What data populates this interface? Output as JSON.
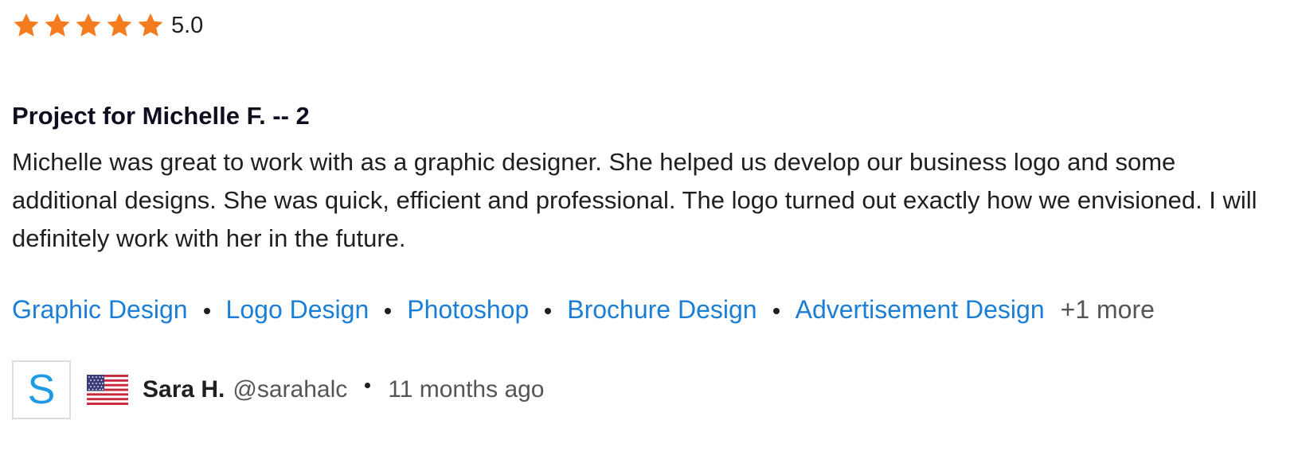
{
  "colors": {
    "star": "#f57b1f",
    "link": "#1b7ed6",
    "avatar_letter": "#1f9be6"
  },
  "review": {
    "rating": {
      "stars": 5,
      "value": "5.0"
    },
    "title": "Project for Michelle F. -- 2",
    "body": "Michelle was great to work with as a graphic designer. She helped us develop our business logo and some additional designs. She was quick, efficient and professional. The logo turned out exactly how we envisioned. I will definitely work with her in the future.",
    "skills": [
      "Graphic Design",
      "Logo Design",
      "Photoshop",
      "Brochure Design",
      "Advertisement Design"
    ],
    "more_skills": "+1 more",
    "reviewer": {
      "avatar_letter": "S",
      "flag_icon": "us-flag-icon",
      "name": "Sara H.",
      "handle": "@sarahalc",
      "time_ago": "11 months ago"
    }
  }
}
